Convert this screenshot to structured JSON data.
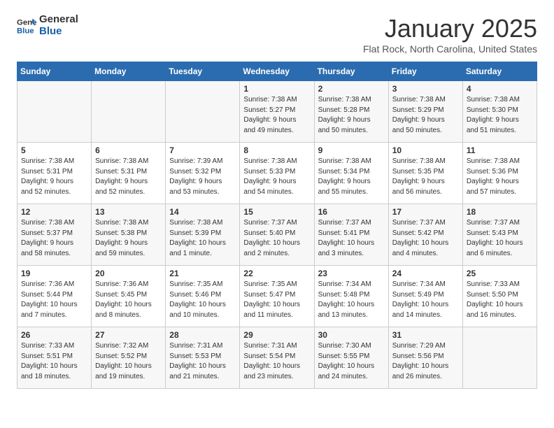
{
  "header": {
    "logo_line1": "General",
    "logo_line2": "Blue",
    "month": "January 2025",
    "location": "Flat Rock, North Carolina, United States"
  },
  "days_of_week": [
    "Sunday",
    "Monday",
    "Tuesday",
    "Wednesday",
    "Thursday",
    "Friday",
    "Saturday"
  ],
  "weeks": [
    [
      {
        "day": "",
        "info": ""
      },
      {
        "day": "",
        "info": ""
      },
      {
        "day": "",
        "info": ""
      },
      {
        "day": "1",
        "info": "Sunrise: 7:38 AM\nSunset: 5:27 PM\nDaylight: 9 hours\nand 49 minutes."
      },
      {
        "day": "2",
        "info": "Sunrise: 7:38 AM\nSunset: 5:28 PM\nDaylight: 9 hours\nand 50 minutes."
      },
      {
        "day": "3",
        "info": "Sunrise: 7:38 AM\nSunset: 5:29 PM\nDaylight: 9 hours\nand 50 minutes."
      },
      {
        "day": "4",
        "info": "Sunrise: 7:38 AM\nSunset: 5:30 PM\nDaylight: 9 hours\nand 51 minutes."
      }
    ],
    [
      {
        "day": "5",
        "info": "Sunrise: 7:38 AM\nSunset: 5:31 PM\nDaylight: 9 hours\nand 52 minutes."
      },
      {
        "day": "6",
        "info": "Sunrise: 7:38 AM\nSunset: 5:31 PM\nDaylight: 9 hours\nand 52 minutes."
      },
      {
        "day": "7",
        "info": "Sunrise: 7:39 AM\nSunset: 5:32 PM\nDaylight: 9 hours\nand 53 minutes."
      },
      {
        "day": "8",
        "info": "Sunrise: 7:38 AM\nSunset: 5:33 PM\nDaylight: 9 hours\nand 54 minutes."
      },
      {
        "day": "9",
        "info": "Sunrise: 7:38 AM\nSunset: 5:34 PM\nDaylight: 9 hours\nand 55 minutes."
      },
      {
        "day": "10",
        "info": "Sunrise: 7:38 AM\nSunset: 5:35 PM\nDaylight: 9 hours\nand 56 minutes."
      },
      {
        "day": "11",
        "info": "Sunrise: 7:38 AM\nSunset: 5:36 PM\nDaylight: 9 hours\nand 57 minutes."
      }
    ],
    [
      {
        "day": "12",
        "info": "Sunrise: 7:38 AM\nSunset: 5:37 PM\nDaylight: 9 hours\nand 58 minutes."
      },
      {
        "day": "13",
        "info": "Sunrise: 7:38 AM\nSunset: 5:38 PM\nDaylight: 9 hours\nand 59 minutes."
      },
      {
        "day": "14",
        "info": "Sunrise: 7:38 AM\nSunset: 5:39 PM\nDaylight: 10 hours\nand 1 minute."
      },
      {
        "day": "15",
        "info": "Sunrise: 7:37 AM\nSunset: 5:40 PM\nDaylight: 10 hours\nand 2 minutes."
      },
      {
        "day": "16",
        "info": "Sunrise: 7:37 AM\nSunset: 5:41 PM\nDaylight: 10 hours\nand 3 minutes."
      },
      {
        "day": "17",
        "info": "Sunrise: 7:37 AM\nSunset: 5:42 PM\nDaylight: 10 hours\nand 4 minutes."
      },
      {
        "day": "18",
        "info": "Sunrise: 7:37 AM\nSunset: 5:43 PM\nDaylight: 10 hours\nand 6 minutes."
      }
    ],
    [
      {
        "day": "19",
        "info": "Sunrise: 7:36 AM\nSunset: 5:44 PM\nDaylight: 10 hours\nand 7 minutes."
      },
      {
        "day": "20",
        "info": "Sunrise: 7:36 AM\nSunset: 5:45 PM\nDaylight: 10 hours\nand 8 minutes."
      },
      {
        "day": "21",
        "info": "Sunrise: 7:35 AM\nSunset: 5:46 PM\nDaylight: 10 hours\nand 10 minutes."
      },
      {
        "day": "22",
        "info": "Sunrise: 7:35 AM\nSunset: 5:47 PM\nDaylight: 10 hours\nand 11 minutes."
      },
      {
        "day": "23",
        "info": "Sunrise: 7:34 AM\nSunset: 5:48 PM\nDaylight: 10 hours\nand 13 minutes."
      },
      {
        "day": "24",
        "info": "Sunrise: 7:34 AM\nSunset: 5:49 PM\nDaylight: 10 hours\nand 14 minutes."
      },
      {
        "day": "25",
        "info": "Sunrise: 7:33 AM\nSunset: 5:50 PM\nDaylight: 10 hours\nand 16 minutes."
      }
    ],
    [
      {
        "day": "26",
        "info": "Sunrise: 7:33 AM\nSunset: 5:51 PM\nDaylight: 10 hours\nand 18 minutes."
      },
      {
        "day": "27",
        "info": "Sunrise: 7:32 AM\nSunset: 5:52 PM\nDaylight: 10 hours\nand 19 minutes."
      },
      {
        "day": "28",
        "info": "Sunrise: 7:31 AM\nSunset: 5:53 PM\nDaylight: 10 hours\nand 21 minutes."
      },
      {
        "day": "29",
        "info": "Sunrise: 7:31 AM\nSunset: 5:54 PM\nDaylight: 10 hours\nand 23 minutes."
      },
      {
        "day": "30",
        "info": "Sunrise: 7:30 AM\nSunset: 5:55 PM\nDaylight: 10 hours\nand 24 minutes."
      },
      {
        "day": "31",
        "info": "Sunrise: 7:29 AM\nSunset: 5:56 PM\nDaylight: 10 hours\nand 26 minutes."
      },
      {
        "day": "",
        "info": ""
      }
    ]
  ]
}
